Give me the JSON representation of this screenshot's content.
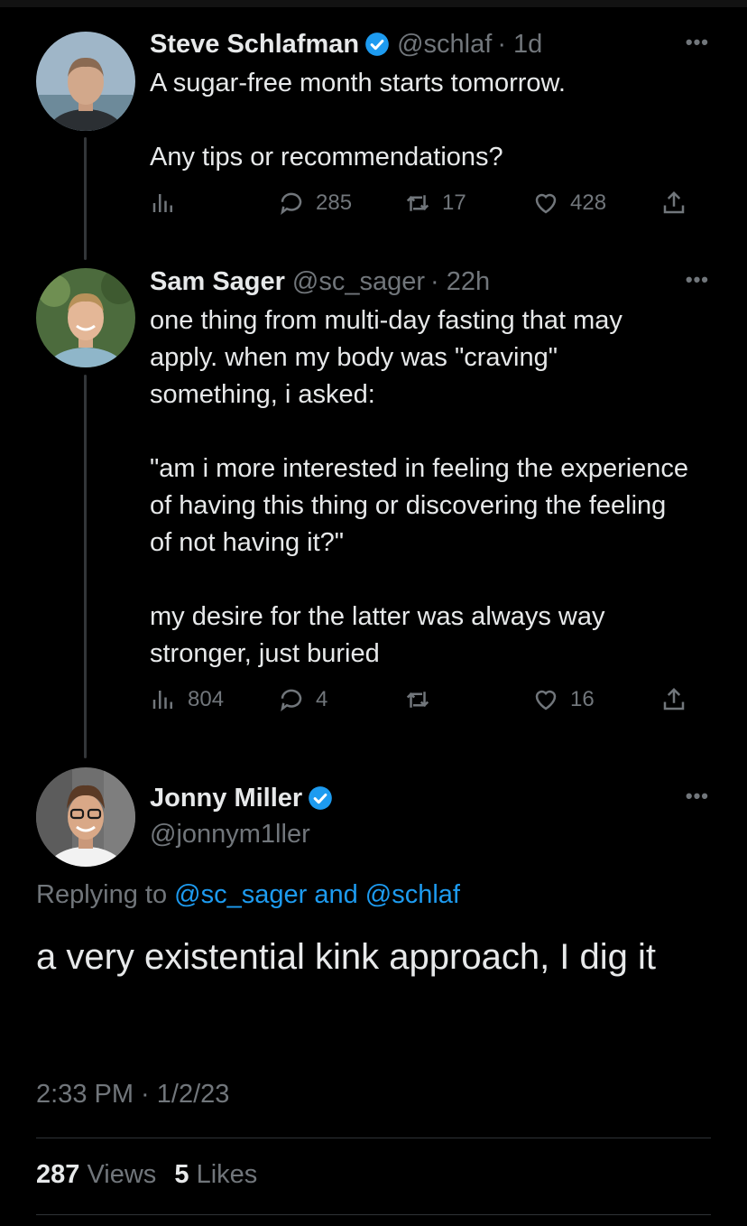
{
  "tweets": [
    {
      "name": "Steve Schlafman",
      "handle": "@schlaf",
      "time": "· 1d",
      "text": [
        "A sugar-free month starts tomorrow.",
        "Any tips or recommendations?"
      ],
      "views": "",
      "replies": "285",
      "retweets": "17",
      "likes": "428"
    },
    {
      "name": "Sam Sager",
      "handle": "@sc_sager",
      "time": "· 22h",
      "text": [
        "one thing from multi-day fasting that may apply. when my body was \"craving\" something, i asked:",
        "\"am i more interested in feeling the experience of having this thing or discovering the feeling of not having it?\"",
        "my desire for the latter was always way stronger, just buried"
      ],
      "views": "804",
      "replies": "4",
      "retweets": "",
      "likes": "16"
    }
  ],
  "main_tweet": {
    "name": "Jonny Miller",
    "handle": "@jonnym1ller",
    "replying_prefix": "Replying to",
    "replying_to": "@sc_sager and @schlaf",
    "text": "a very existential kink approach, I dig it",
    "timestamp": "2:33 PM · 1/2/23",
    "views_count": "287",
    "views_label": "Views",
    "likes_count": "5",
    "likes_label": "Likes"
  },
  "colors": {
    "background": "#000000",
    "accent": "#1d9bf0",
    "muted": "#71767b"
  }
}
